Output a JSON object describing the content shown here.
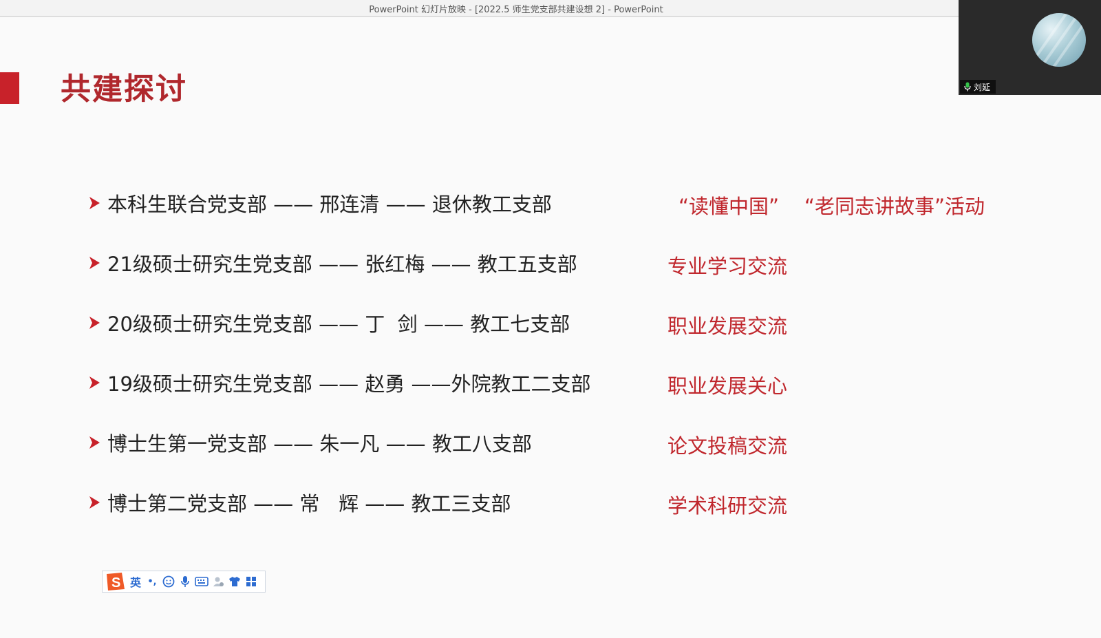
{
  "window": {
    "title": "PowerPoint 幻灯片放映 - [2022.5 师生党支部共建设想 2] - PowerPoint"
  },
  "slide": {
    "title": "共建探讨",
    "colors": {
      "accent": "#c8222a",
      "title": "#b0282d",
      "note": "#c0272d",
      "text": "#222222"
    },
    "rows": [
      {
        "text": "本科生联合党支部 —— 邢连清 —— 退休教工支部",
        "note": "“读懂中国”    “老同志讲故事”活动"
      },
      {
        "text": "21级硕士研究生党支部 —— 张红梅 —— 教工五支部",
        "note": "专业学习交流"
      },
      {
        "text": "20级硕士研究生党支部 —— 丁  剑 —— 教工七支部",
        "note": "职业发展交流"
      },
      {
        "text": "19级硕士研究生党支部 —— 赵勇 ——外院教工二支部",
        "note": "职业发展关心"
      },
      {
        "text": "博士生第一党支部 —— 朱一凡 —— 教工八支部",
        "note": "论文投稿交流"
      },
      {
        "text": "博士第二党支部 —— 常   辉 —— 教工三支部",
        "note": "学术科研交流"
      }
    ]
  },
  "video": {
    "participant_name": "刘延",
    "mic_icon": "microphone-icon"
  },
  "ime_toolbar": {
    "mode_label": "英",
    "punct_label": "•,",
    "icons": [
      "sogou-logo-icon",
      "emoji-icon",
      "voice-icon",
      "keyboard-icon",
      "user-icon",
      "skin-icon",
      "toolbox-icon"
    ]
  }
}
